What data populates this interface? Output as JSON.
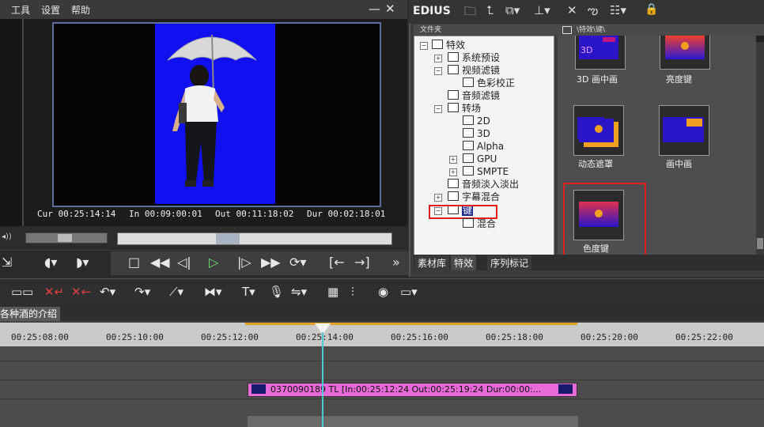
{
  "menu": {
    "tools": "工具",
    "settings": "设置",
    "help": "帮助",
    "minimize": "—",
    "close": "✕"
  },
  "preview": {
    "cur": "Cur 00:25:14:14",
    "in": "In 00:09:00:01",
    "out": "Out 00:11:18:02",
    "dur": "Dur 00:02:18:01"
  },
  "library": {
    "app_name": "EDIUS",
    "folder_header": "文件夹",
    "path_header": "\\特效\\键\\",
    "tree": [
      {
        "label": "特效"
      },
      {
        "label": "系统预设"
      },
      {
        "label": "视频滤镜"
      },
      {
        "label": "色彩校正"
      },
      {
        "label": "音频滤镜"
      },
      {
        "label": "转场"
      },
      {
        "label": "2D"
      },
      {
        "label": "3D"
      },
      {
        "label": "Alpha"
      },
      {
        "label": "GPU"
      },
      {
        "label": "SMPTE"
      },
      {
        "label": "音频淡入淡出"
      },
      {
        "label": "字幕混合"
      },
      {
        "label": "键"
      },
      {
        "label": "混合"
      }
    ],
    "effects": [
      {
        "label": "3D 画中画",
        "thumb_text": "3D"
      },
      {
        "label": "亮度键"
      },
      {
        "label": "动态遮罩"
      },
      {
        "label": "画中画"
      },
      {
        "label": "色度键"
      }
    ],
    "tabs": [
      "素材库",
      "特效",
      "序列标记"
    ]
  },
  "timeline": {
    "sequence_tab": "各种酒的介绍",
    "ruler": [
      "00:25:08:00",
      "00:25:10:00",
      "00:25:12:00",
      "00:25:14:00",
      "00:25:16:00",
      "00:25:18:00",
      "00:25:20:00",
      "00:25:22:00"
    ],
    "clip_text": "0370090189  TL [In:00:25:12:24 Out:00:25:19:24 Dur:00:00:..."
  },
  "colors": {
    "highlight": "#e02020",
    "chroma_blue": "#1010f0",
    "clip": "#e86ad8",
    "playhead": "#50c8d8"
  }
}
